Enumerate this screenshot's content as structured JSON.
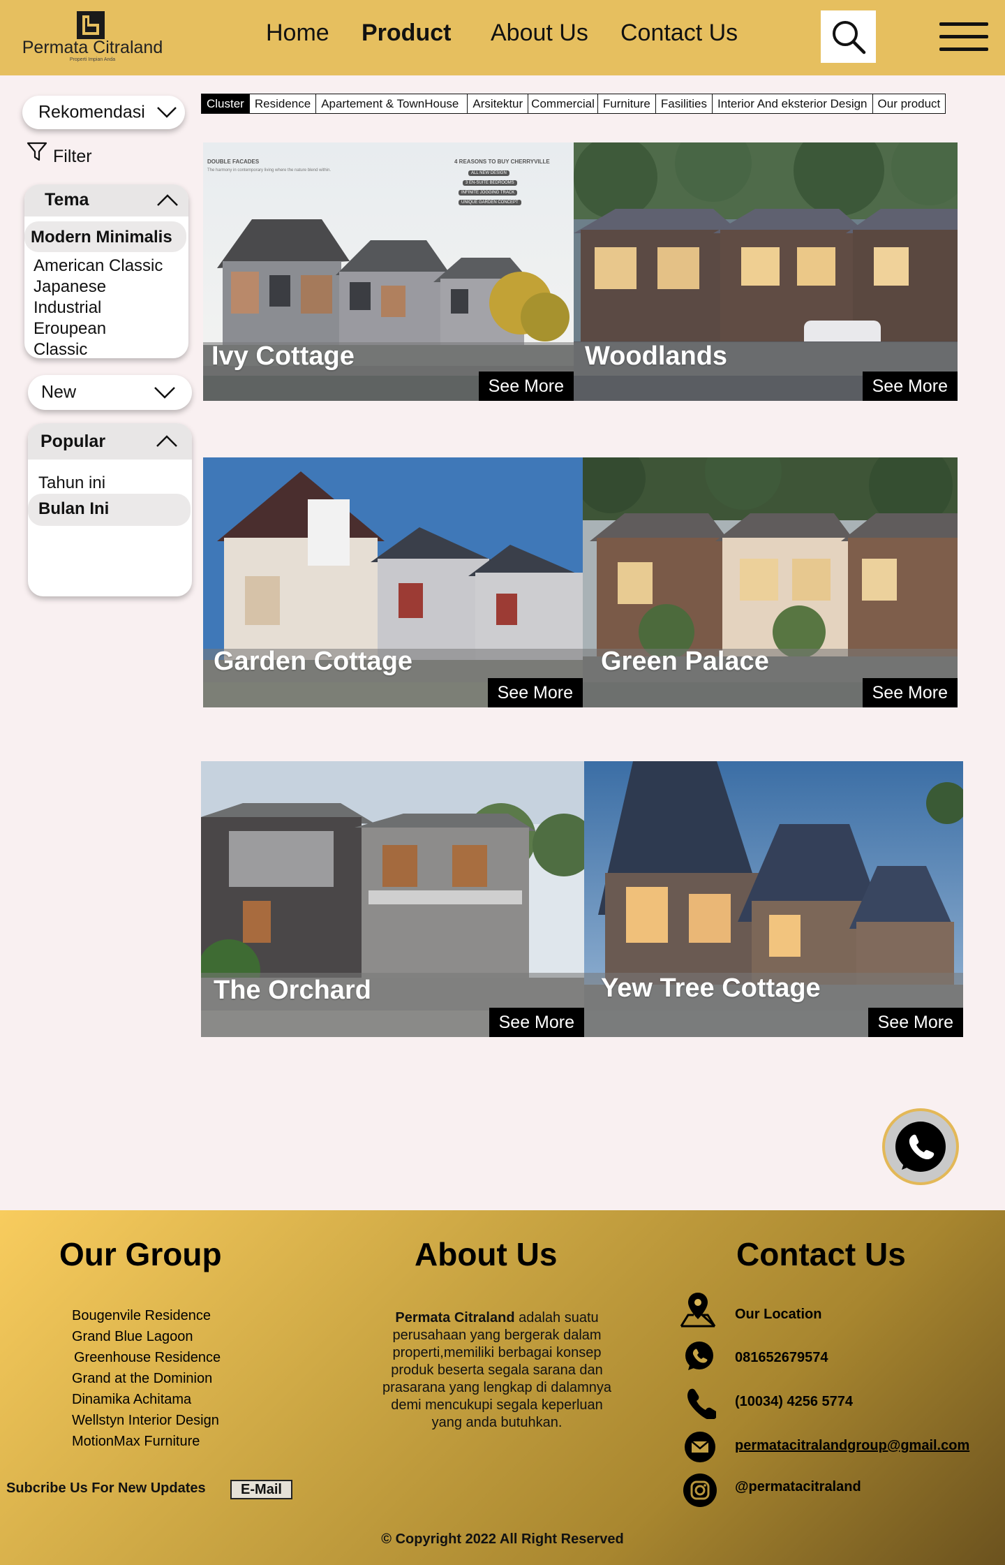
{
  "header": {
    "brand": "Permata Citraland",
    "tagline": "Properti Impian Anda",
    "nav": [
      "Home",
      "Product",
      "About Us",
      "Contact Us"
    ],
    "active_nav": "Product"
  },
  "sidebar": {
    "sort_label": "Rekomendasi",
    "filter_label": "Filter",
    "tema": {
      "title": "Tema",
      "selected": "Modern Minimalis",
      "options": [
        "American Classic",
        "Japanese",
        "Industrial",
        "Eroupean",
        "Classic"
      ]
    },
    "new_label": "New",
    "popular": {
      "title": "Popular",
      "options": [
        "Tahun ini"
      ],
      "selected": "Bulan Ini"
    }
  },
  "tabs": [
    "Cluster",
    "Residence",
    "Apartement & TownHouse",
    "Arsitektur",
    "Commercial",
    "Furniture",
    "Fasilities",
    "Interior And eksterior Design",
    "Our product"
  ],
  "active_tab": "Cluster",
  "cards": [
    {
      "title": "Ivy Cottage",
      "cta": "See More"
    },
    {
      "title": "Woodlands",
      "cta": "See More"
    },
    {
      "title": "Garden Cottage",
      "cta": "See More"
    },
    {
      "title": "Green Palace",
      "cta": "See More"
    },
    {
      "title": "The Orchard",
      "cta": "See More"
    },
    {
      "title": "Yew Tree Cottage",
      "cta": "See More"
    }
  ],
  "promo": {
    "heading": "DOUBLE FACADES",
    "sub": "The harmony in contemporary living where the nature blend within.",
    "reasons_title": "4 REASONS TO BUY CHERRYVILLE",
    "reasons": [
      "ALL NEW DESIGN",
      "3 EN-SUITE BEDROOMS",
      "INFINITE JOGGING TRACK",
      "UNIQUE GARDEN CONCEPT"
    ]
  },
  "footer": {
    "group_title": "Our Group",
    "group_links": [
      "Bougenvile Residence",
      "Grand Blue Lagoon",
      "Greenhouse Residence",
      "Grand at the Dominion",
      "Dinamika Achitama",
      "Wellstyn Interior Design",
      "MotionMax Furniture"
    ],
    "about_title": "About Us",
    "about_company": "Permata Citraland",
    "about_text": " adalah suatu perusahaan yang bergerak dalam properti,memiliki berbagai konsep produk beserta segala sarana dan prasarana yang lengkap di dalamnya demi mencukupi segala keperluan yang anda butuhkan.",
    "contact_title": "Contact Us",
    "location": "Our Location",
    "whatsapp": "081652679574",
    "phone": "(10034) 4256 5774",
    "email": "permatacitralandgroup@gmail.com",
    "instagram": "@permatacitraland",
    "subscribe_label": "Subcribe Us For New Updates",
    "email_button": "E-Mail",
    "copyright": "© Copyright 2022  All Right Reserved"
  }
}
